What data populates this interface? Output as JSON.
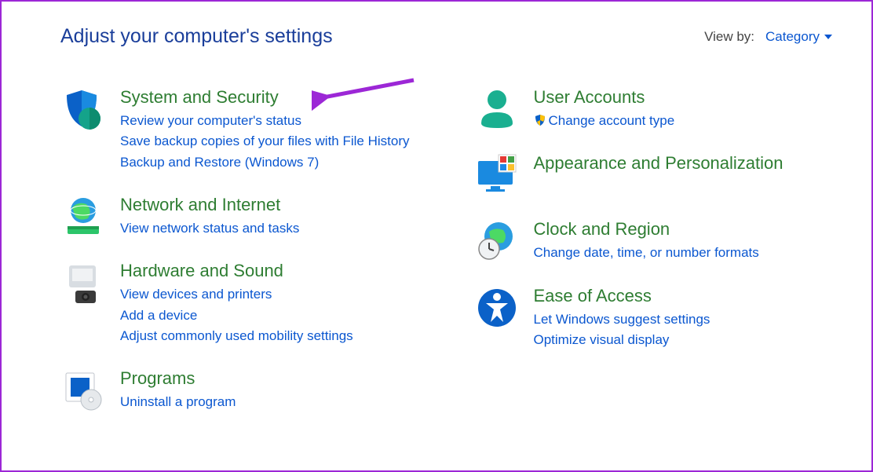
{
  "header": {
    "title": "Adjust your computer's settings",
    "viewby_label": "View by:",
    "viewby_value": "Category"
  },
  "left": [
    {
      "id": "system-security",
      "title": "System and Security",
      "links": [
        "Review your computer's status",
        "Save backup copies of your files with File History",
        "Backup and Restore (Windows 7)"
      ]
    },
    {
      "id": "network-internet",
      "title": "Network and Internet",
      "links": [
        "View network status and tasks"
      ]
    },
    {
      "id": "hardware-sound",
      "title": "Hardware and Sound",
      "links": [
        "View devices and printers",
        "Add a device",
        "Adjust commonly used mobility settings"
      ]
    },
    {
      "id": "programs",
      "title": "Programs",
      "links": [
        "Uninstall a program"
      ]
    }
  ],
  "right": [
    {
      "id": "user-accounts",
      "title": "User Accounts",
      "links": [
        "Change account type"
      ],
      "shield": true
    },
    {
      "id": "appearance-personalization",
      "title": "Appearance and Personalization",
      "links": []
    },
    {
      "id": "clock-region",
      "title": "Clock and Region",
      "links": [
        "Change date, time, or number formats"
      ]
    },
    {
      "id": "ease-of-access",
      "title": "Ease of Access",
      "links": [
        "Let Windows suggest settings",
        "Optimize visual display"
      ]
    }
  ]
}
